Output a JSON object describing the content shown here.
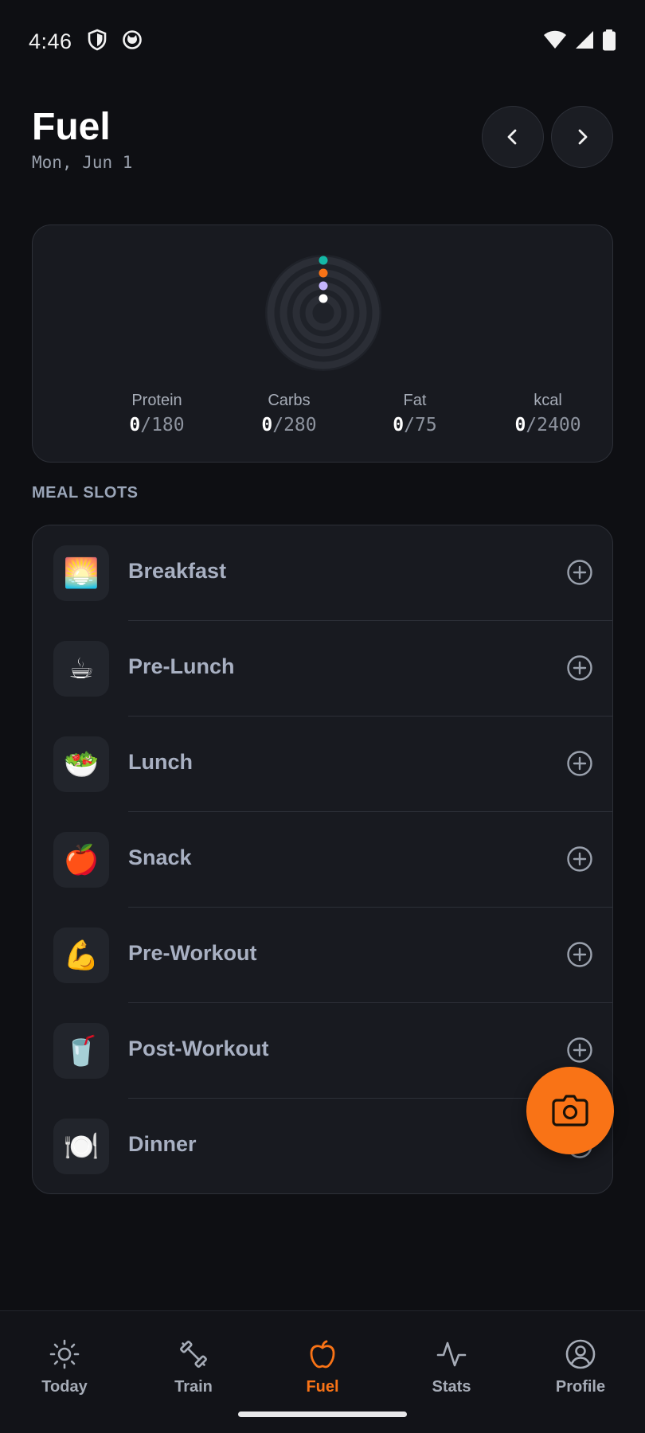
{
  "status_bar": {
    "time": "4:46"
  },
  "header": {
    "title": "Fuel",
    "date": "Mon, Jun 1"
  },
  "macros": [
    {
      "label": "Protein",
      "current": "0",
      "goal": "180",
      "color": "#14b8a6"
    },
    {
      "label": "Carbs",
      "current": "0",
      "goal": "280",
      "color": "#f97316"
    },
    {
      "label": "Fat",
      "current": "0",
      "goal": "75",
      "color": "#c4b5fd"
    },
    {
      "label": "kcal",
      "current": "0",
      "goal": "2400",
      "color": "#ffffff"
    }
  ],
  "section": {
    "meal_slots_label": "MEAL SLOTS"
  },
  "meals": [
    {
      "name": "Breakfast",
      "emoji": "🌅",
      "icon": "sunrise-icon"
    },
    {
      "name": "Pre-Lunch",
      "emoji": "☕",
      "icon": "coffee-icon"
    },
    {
      "name": "Lunch",
      "emoji": "🥗",
      "icon": "salad-icon"
    },
    {
      "name": "Snack",
      "emoji": "🍎",
      "icon": "apple-icon"
    },
    {
      "name": "Pre-Workout",
      "emoji": "💪",
      "icon": "flexed-biceps-icon"
    },
    {
      "name": "Post-Workout",
      "emoji": "🥤",
      "icon": "cup-with-straw-icon"
    },
    {
      "name": "Dinner",
      "emoji": "🍽️",
      "icon": "plate-icon"
    }
  ],
  "bottom_nav": [
    {
      "label": "Today",
      "icon": "sun-icon",
      "active": false
    },
    {
      "label": "Train",
      "icon": "dumbbell-icon",
      "active": false
    },
    {
      "label": "Fuel",
      "icon": "apple-icon",
      "active": true
    },
    {
      "label": "Stats",
      "icon": "activity-icon",
      "active": false
    },
    {
      "label": "Profile",
      "icon": "user-circle-icon",
      "active": false
    }
  ],
  "colors": {
    "accent": "#f97316",
    "background": "#0e0f13",
    "card": "#181a20"
  }
}
